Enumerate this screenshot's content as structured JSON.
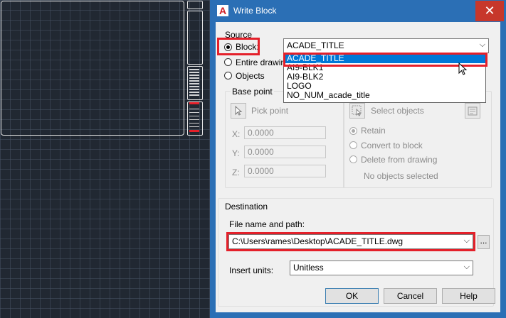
{
  "window": {
    "title": "Write Block",
    "app_icon": "A",
    "close_glyph": "✕",
    "accent": "#2b6fb5"
  },
  "source": {
    "legend": "Source",
    "block_label": "Block:",
    "entire_drawing_label": "Entire drawing",
    "objects_label": "Objects",
    "selected": "Block",
    "block_combo_value": "ACADE_TITLE",
    "block_options": [
      "ACADE_TITLE",
      "AI9-BLK1",
      "AI9-BLK2",
      "LOGO",
      "NO_NUM_acade_title"
    ],
    "highlighted_option": "ACADE_TITLE"
  },
  "base_point": {
    "legend": "Base point",
    "pick_point_label": "Pick point",
    "x_label": "X:",
    "y_label": "Y:",
    "z_label": "Z:",
    "x_value": "0.0000",
    "y_value": "0.0000",
    "z_value": "0.0000"
  },
  "objects": {
    "select_objects_label": "Select objects",
    "retain_label": "Retain",
    "convert_label": "Convert to block",
    "delete_label": "Delete from drawing",
    "status": "No objects selected",
    "selected": "Retain"
  },
  "destination": {
    "legend": "Destination",
    "file_label": "File name and path:",
    "file_value": "C:\\Users\\rames\\Desktop\\ACADE_TITLE.dwg",
    "browse_label": "...",
    "units_label": "Insert units:",
    "units_value": "Unitless"
  },
  "buttons": {
    "ok": "OK",
    "cancel": "Cancel",
    "help": "Help"
  },
  "colors": {
    "highlight": "#e4202a",
    "selection": "#0078d7"
  }
}
